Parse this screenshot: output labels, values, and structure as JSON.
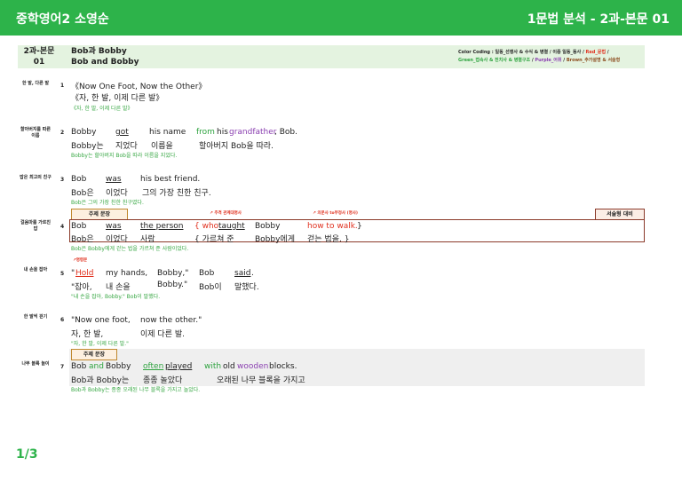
{
  "header": {
    "title": "중학영어2 소영순",
    "right": "1문법 분석 - 2과-본문 01"
  },
  "lesson": {
    "num_line1": "2과-본문",
    "num_line2": "01",
    "title_line1": "Bob과 Bobby",
    "title_line2": "Bob and Bobby"
  },
  "legend": {
    "prefix": "Color Coding : 일동_선행사 & 수식 & 병렬 / 이중 일동_동사 / ",
    "red": "Red_문법",
    "green": "Green_접속사 & 전치사 & 병렬구조",
    "purple": "Purple_어휘",
    "brown": "Brown_추가설명 & 서술형",
    "sep": " / "
  },
  "rows": [
    {
      "label": "한 발, 다른 발",
      "num": "1",
      "en": "《Now One Foot, Now the Other》",
      "ko": "《자, 한 발, 이제 다른 발》",
      "tr": "《자, 한 발, 이제 다른 발》"
    },
    {
      "label1": "할아버지를 따른",
      "label2": "이름",
      "num": "2",
      "en": [
        "Bobby",
        "got",
        "his name",
        "from",
        "his",
        "grandfather",
        ", Bob."
      ],
      "ko": [
        "Bobby는",
        "지었다",
        "이름을",
        "할아버지 Bob을 따라."
      ],
      "tr": "Bobby는 할아버지 Bob을 따라 이름을 지었다."
    },
    {
      "label": "밥은 최고의 친구",
      "num": "3",
      "en": [
        "Bob",
        "was",
        "his best friend."
      ],
      "ko": [
        "Bob은",
        "이었다",
        "그의 가장 친한 친구."
      ],
      "tr": "Bob은 그의 가장 친한 친구였다."
    },
    {
      "label1": "걸음마를 가르친",
      "label2": "밥",
      "num": "4",
      "tag": "주제 문장",
      "box": "서술형 대비",
      "ann1": "주격 관계대명사",
      "ann2": "의문사 to부정사 (명사)",
      "en": [
        "Bob",
        "was",
        "the person",
        "{ who",
        "taught",
        "Bobby",
        "how to walk.",
        "}"
      ],
      "ko": [
        "Bob은",
        "이었다",
        "사람",
        "{ 가르쳐 준",
        "Bobby에게",
        "걷는 법을. }"
      ],
      "tr": "Bob은 Bobby에게 걷는 법을 가르쳐 준 사람이었다."
    },
    {
      "label": "내 손을 잡아",
      "num": "5",
      "ann": "명령문",
      "en": [
        "\"",
        "Hold",
        "my hands,",
        "Bobby,\"",
        "Bob",
        "said",
        "."
      ],
      "ko": [
        "\"잡아,",
        "내 손을",
        "Bobby.\"",
        "Bob이",
        "말했다."
      ],
      "tr": "\"내 손을 잡아, Bobby.\" Bob이 말했다."
    },
    {
      "label": "한 발씩 걷기",
      "num": "6",
      "en": [
        "\"Now one foot,",
        "now the other.\""
      ],
      "ko": [
        "자, 한 발,",
        "이제 다른 발."
      ],
      "tr": "\"자, 한 발, 이제 다른 발.\""
    },
    {
      "label": "나무 블록 놀이",
      "num": "7",
      "tag": "주제 문장",
      "en": [
        "Bob",
        "and",
        "Bobby",
        "often",
        "played",
        "with",
        "old",
        "wooden",
        "blocks."
      ],
      "ko": [
        "Bob과 Bobby는",
        "종종 놀았다",
        "오래된 나무 블록을 가지고"
      ],
      "tr": "Bob과 Bobby는 종종 오래된 나무 블록을 가지고 놀았다."
    }
  ],
  "page": "1/3",
  "colors": {
    "header": "#2db34a",
    "red": "#e0301e",
    "green": "#2ea33f",
    "purple": "#8a3fb0",
    "brown": "#8b3a2a"
  }
}
